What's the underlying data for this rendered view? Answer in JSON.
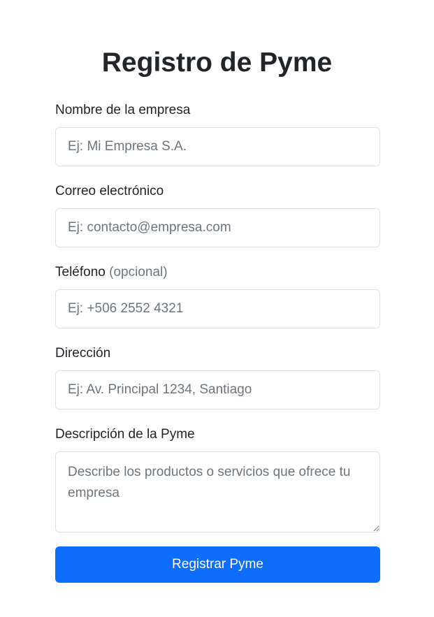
{
  "title": "Registro de Pyme",
  "fields": [
    {
      "label": "Nombre de la empresa",
      "placeholder": "Ej: Mi Empresa S.A."
    },
    {
      "label": "Correo electrónico",
      "placeholder": "Ej: contacto@empresa.com"
    },
    {
      "label": "Teléfono",
      "label_hint": "(opcional)",
      "placeholder": "Ej: +506 2552 4321"
    },
    {
      "label": "Dirección",
      "placeholder": "Ej: Av. Principal 1234, Santiago"
    },
    {
      "label": "Descripción de la Pyme",
      "placeholder": "Describe los productos o servicios que ofrece tu empresa"
    }
  ],
  "submit_label": "Registrar Pyme",
  "colors": {
    "primary": "#0d6efd"
  }
}
